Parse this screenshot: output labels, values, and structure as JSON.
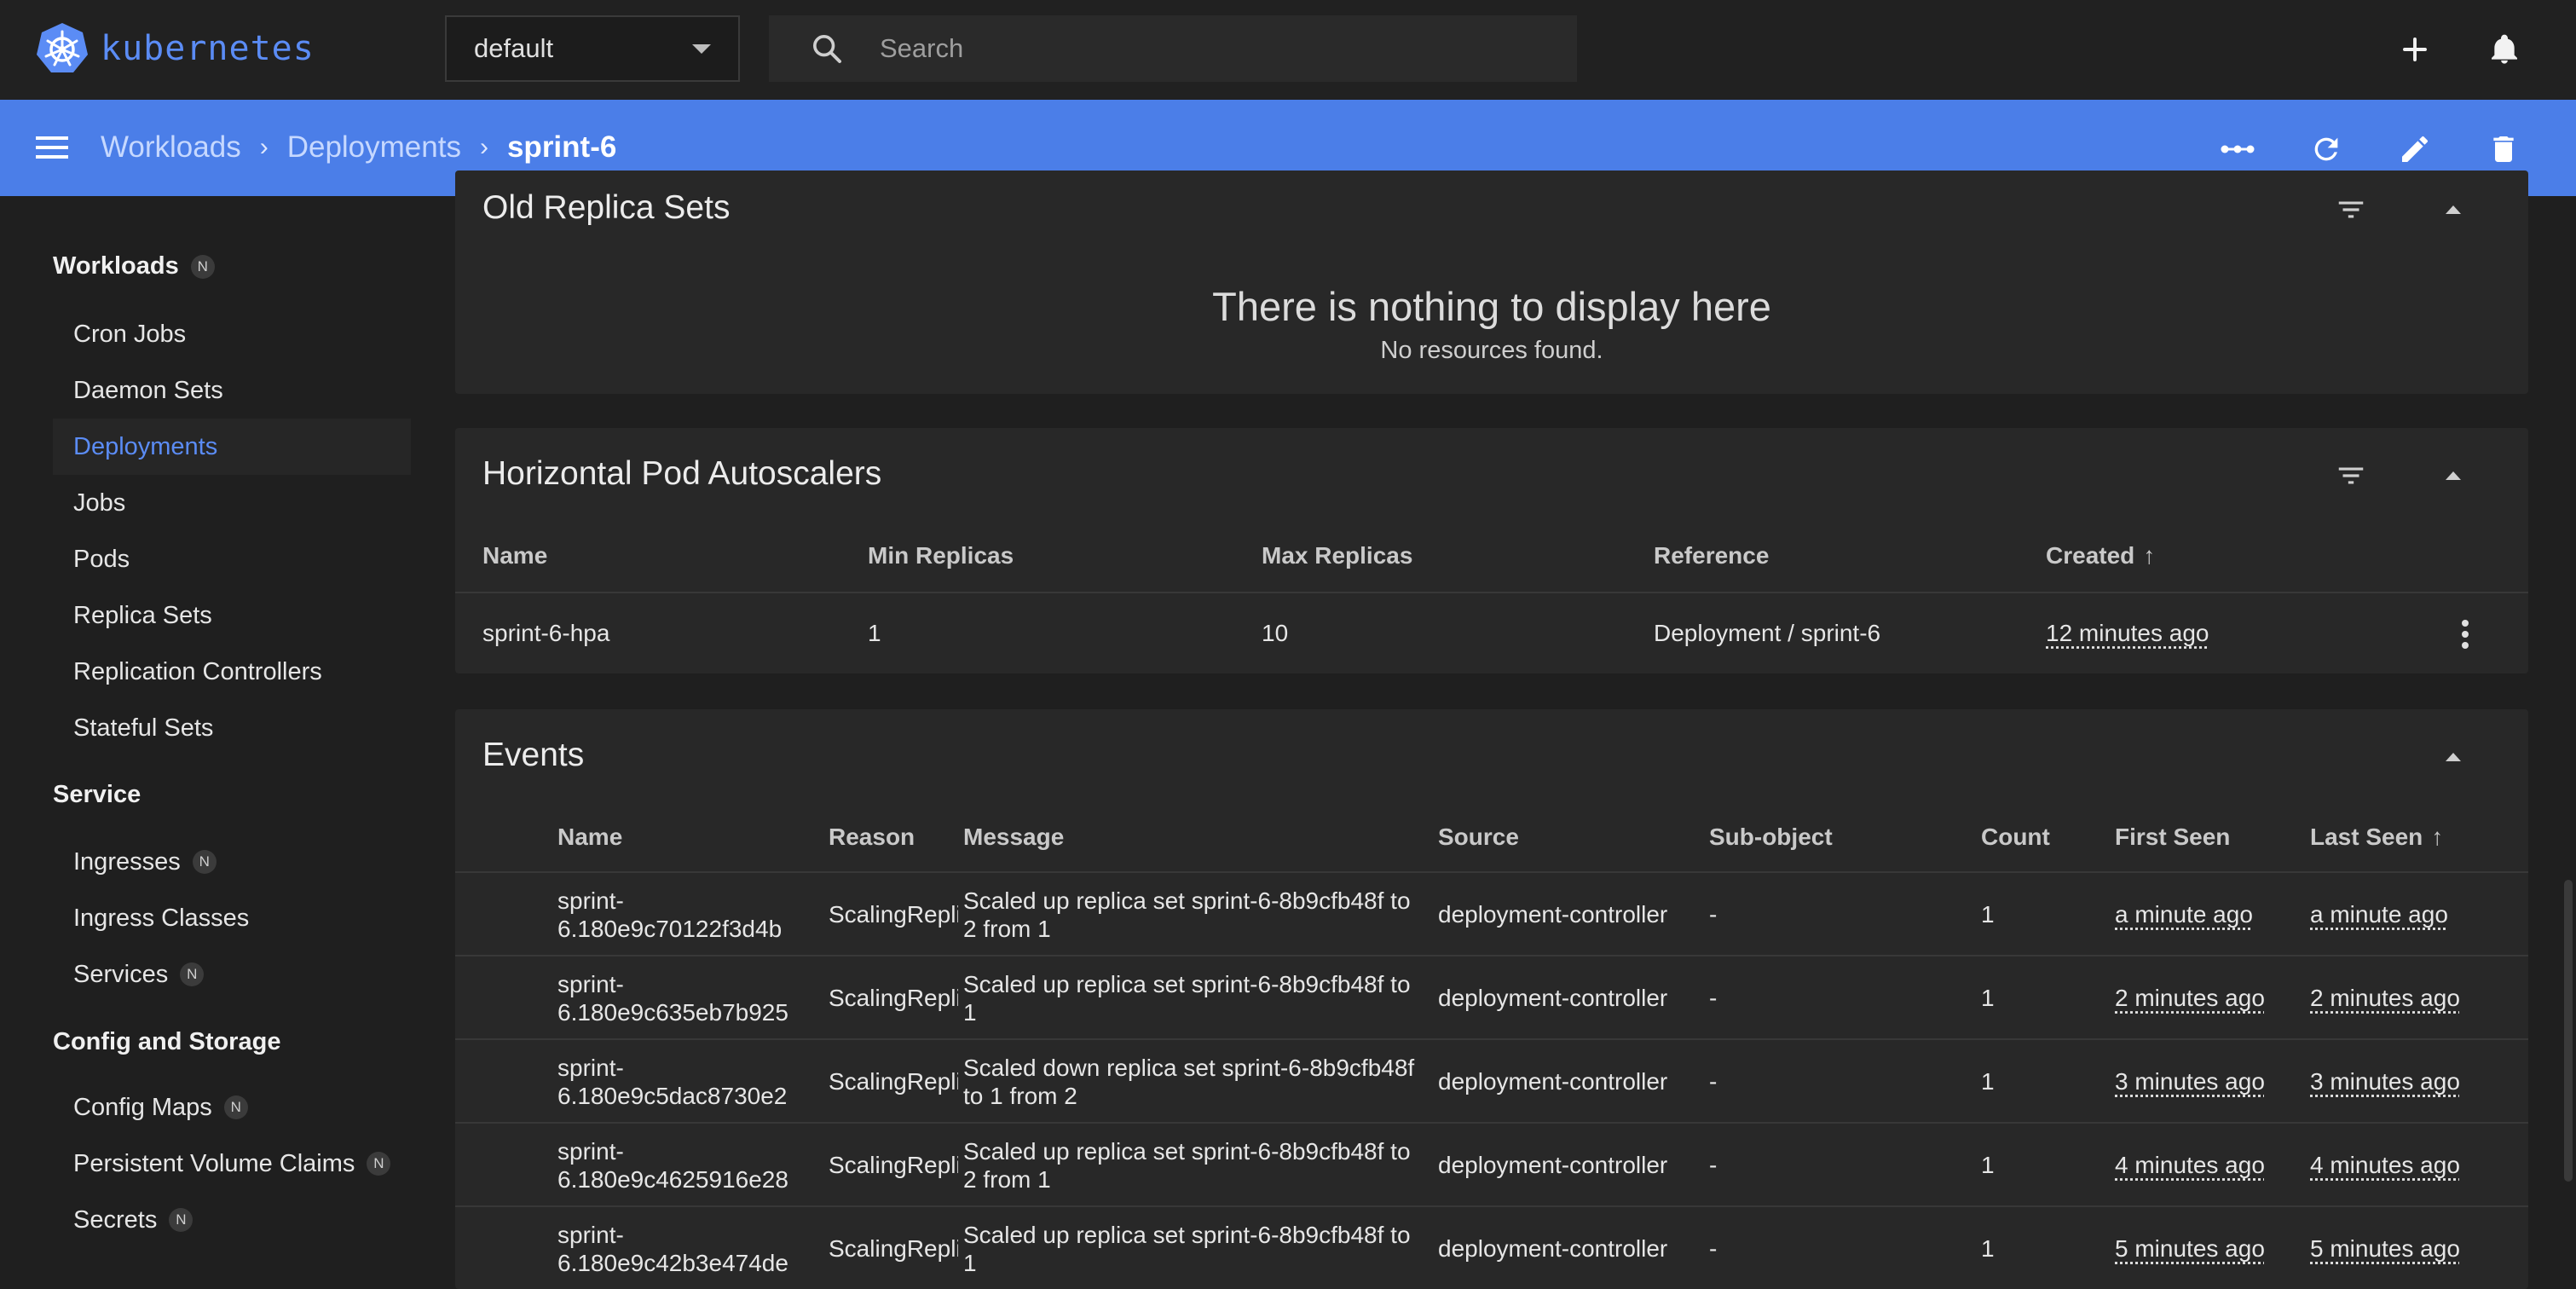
{
  "app": {
    "name": "kubernetes"
  },
  "namespace": {
    "selected": "default"
  },
  "search": {
    "placeholder": "Search"
  },
  "breadcrumb": {
    "items": [
      "Workloads",
      "Deployments"
    ],
    "current": "sprint-6"
  },
  "sidebar": {
    "groups": [
      {
        "label": "Workloads",
        "badge": "N"
      },
      {
        "label": "Service"
      },
      {
        "label": "Config and Storage"
      }
    ],
    "items": [
      {
        "label": "Cron Jobs"
      },
      {
        "label": "Daemon Sets"
      },
      {
        "label": "Deployments"
      },
      {
        "label": "Jobs"
      },
      {
        "label": "Pods"
      },
      {
        "label": "Replica Sets"
      },
      {
        "label": "Replication Controllers"
      },
      {
        "label": "Stateful Sets"
      },
      {
        "label": "Ingresses",
        "badge": "N"
      },
      {
        "label": "Ingress Classes"
      },
      {
        "label": "Services",
        "badge": "N"
      },
      {
        "label": "Config Maps",
        "badge": "N"
      },
      {
        "label": "Persistent Volume Claims",
        "badge": "N"
      },
      {
        "label": "Secrets",
        "badge": "N"
      }
    ]
  },
  "old_replica_sets": {
    "title": "Old Replica Sets",
    "empty_title": "There is nothing to display here",
    "empty_subtitle": "No resources found."
  },
  "hpa": {
    "title": "Horizontal Pod Autoscalers",
    "columns": [
      "Name",
      "Min Replicas",
      "Max Replicas",
      "Reference",
      "Created"
    ],
    "rows": [
      {
        "name": "sprint-6-hpa",
        "min": "1",
        "max": "10",
        "reference": "Deployment / sprint-6",
        "created": "12 minutes ago"
      }
    ]
  },
  "events": {
    "title": "Events",
    "columns": [
      "Name",
      "Reason",
      "Message",
      "Source",
      "Sub-object",
      "Count",
      "First Seen",
      "Last Seen"
    ],
    "rows": [
      {
        "name1": "sprint-",
        "name2": "6.180e9c70122f3d4b",
        "reason": "ScalingRepli",
        "msg1": "Scaled up replica set sprint-6-8b9cfb48f to",
        "msg2": "2 from 1",
        "source": "deployment-controller",
        "sub": "-",
        "count": "1",
        "first": "a minute ago",
        "last": "a minute ago"
      },
      {
        "name1": "sprint-",
        "name2": "6.180e9c635eb7b925",
        "reason": "ScalingRepli",
        "msg1": "Scaled up replica set sprint-6-8b9cfb48f to",
        "msg2": "1",
        "source": "deployment-controller",
        "sub": "-",
        "count": "1",
        "first": "2 minutes ago",
        "last": "2 minutes ago"
      },
      {
        "name1": "sprint-",
        "name2": "6.180e9c5dac8730e2",
        "reason": "ScalingRepli",
        "msg1": "Scaled down replica set sprint-6-8b9cfb48f",
        "msg2": "to 1 from 2",
        "source": "deployment-controller",
        "sub": "-",
        "count": "1",
        "first": "3 minutes ago",
        "last": "3 minutes ago"
      },
      {
        "name1": "sprint-",
        "name2": "6.180e9c4625916e28",
        "reason": "ScalingRepli",
        "msg1": "Scaled up replica set sprint-6-8b9cfb48f to",
        "msg2": "2 from 1",
        "source": "deployment-controller",
        "sub": "-",
        "count": "1",
        "first": "4 minutes ago",
        "last": "4 minutes ago"
      },
      {
        "name1": "sprint-",
        "name2": "6.180e9c42b3e474de",
        "reason": "ScalingRepli",
        "msg1": "Scaled up replica set sprint-6-8b9cfb48f to",
        "msg2": "1",
        "source": "deployment-controller",
        "sub": "-",
        "count": "1",
        "first": "5 minutes ago",
        "last": "5 minutes ago"
      }
    ]
  },
  "colors": {
    "accent": "#4b7ee8",
    "brand": "#5b8cf5",
    "background": "#1f1f1f",
    "panel": "#282828"
  }
}
